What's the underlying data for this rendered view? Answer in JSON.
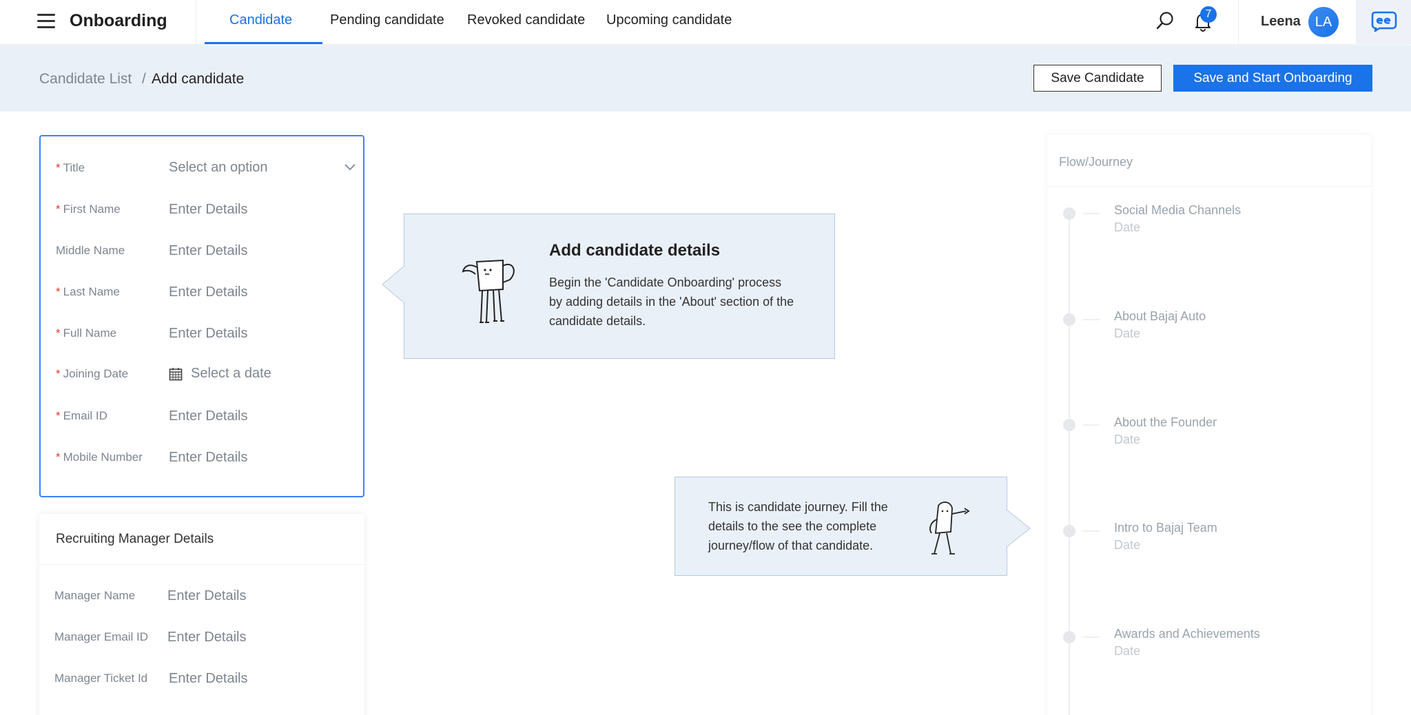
{
  "header": {
    "app_title": "Onboarding",
    "tabs": [
      {
        "label": "Candidate",
        "active": true
      },
      {
        "label": "Pending candidate",
        "active": false
      },
      {
        "label": "Revoked candidate",
        "active": false
      },
      {
        "label": "Upcoming candidate",
        "active": false
      }
    ],
    "notification_count": "7",
    "user_name": "Leena",
    "user_initials": "LA"
  },
  "breadcrumb": {
    "parent": "Candidate List",
    "separator": "/",
    "current": "Add candidate"
  },
  "actions": {
    "save_label": "Save Candidate",
    "save_start_label": "Save and Start Onboarding"
  },
  "form": {
    "title": {
      "label": "Title",
      "required": true,
      "value": "Select an option"
    },
    "first_name": {
      "label": "First Name",
      "required": true,
      "placeholder": "Enter Details"
    },
    "middle_name": {
      "label": "Middle Name",
      "required": false,
      "placeholder": "Enter Details"
    },
    "last_name": {
      "label": "Last Name",
      "required": true,
      "placeholder": "Enter Details"
    },
    "full_name": {
      "label": "Full Name",
      "required": true,
      "placeholder": "Enter Details"
    },
    "joining_date": {
      "label": "Joining Date",
      "required": true,
      "value": "Select a date"
    },
    "email": {
      "label": "Email ID",
      "required": true,
      "placeholder": "Enter Details"
    },
    "mobile": {
      "label": "Mobile Number",
      "required": true,
      "placeholder": "Enter Details"
    }
  },
  "manager": {
    "title": "Recruiting Manager Details",
    "name": {
      "label": "Manager Name",
      "placeholder": "Enter Details"
    },
    "email": {
      "label": "Manager Email ID",
      "placeholder": "Enter Details"
    },
    "ticket": {
      "label": "Manager Ticket Id",
      "placeholder": "Enter Details"
    }
  },
  "tip_details": {
    "title": "Add candidate details",
    "body": "Begin the 'Candidate Onboarding' process by adding details in the 'About' section of the candidate details."
  },
  "tip_journey": {
    "body": "This is candidate journey. Fill the details to the see the complete journey/flow of that candidate."
  },
  "flow": {
    "title": "Flow/Journey",
    "steps": [
      {
        "name": "Social Media Channels",
        "date": "Date"
      },
      {
        "name": "About Bajaj Auto",
        "date": "Date"
      },
      {
        "name": "About the Founder",
        "date": "Date"
      },
      {
        "name": "Intro to Bajaj Team",
        "date": "Date"
      },
      {
        "name": "Awards and Achievements",
        "date": "Date"
      }
    ]
  },
  "colors": {
    "accent": "#1a73e8",
    "required": "#e53935",
    "tip_bg": "#eaf0f8"
  }
}
